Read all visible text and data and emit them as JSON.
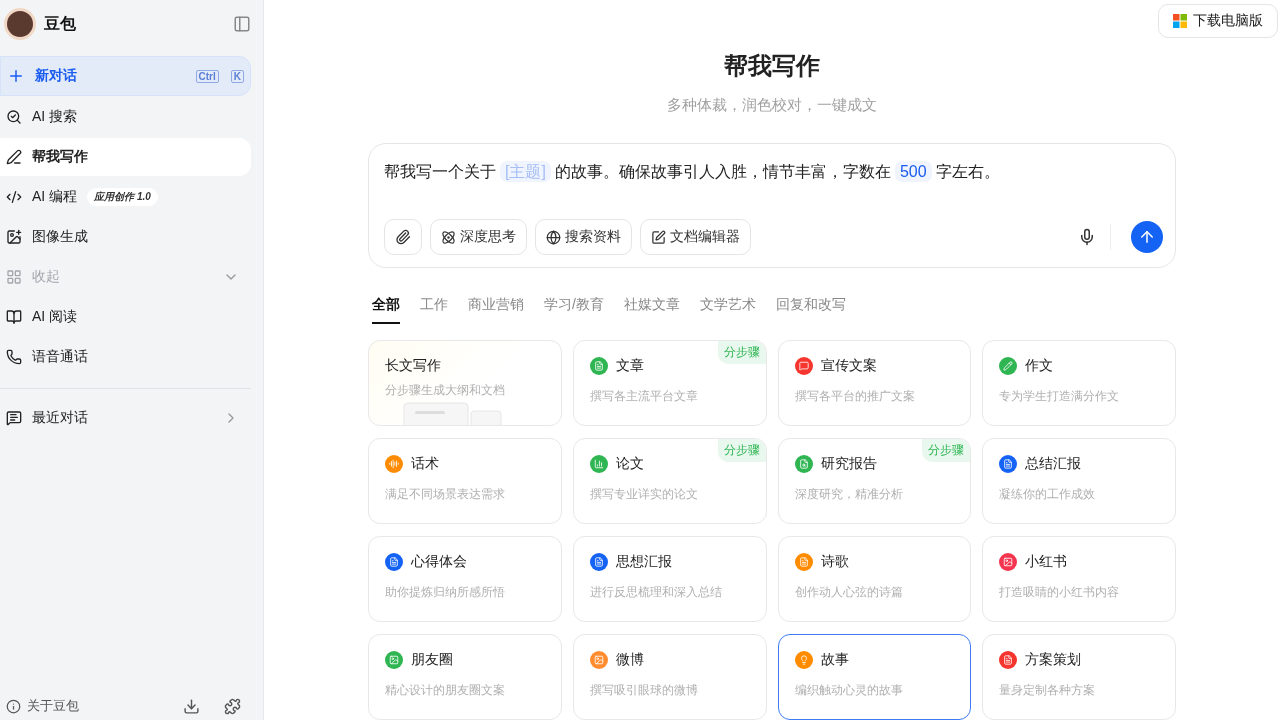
{
  "sidebar": {
    "app_name": "豆包",
    "new_chat": {
      "label": "新对话",
      "shortcut": [
        "Ctrl",
        "K"
      ]
    },
    "items": [
      {
        "kind": "search",
        "label": "AI 搜索",
        "selected": false
      },
      {
        "kind": "write",
        "label": "帮我写作",
        "selected": true
      },
      {
        "kind": "code",
        "label": "AI 编程",
        "selected": false,
        "badge": "应用创作 1.0"
      },
      {
        "kind": "image",
        "label": "图像生成",
        "selected": false
      },
      {
        "kind": "collapse",
        "label": "收起",
        "selected": false
      },
      {
        "kind": "read",
        "label": "AI 阅读",
        "selected": false
      },
      {
        "kind": "phone",
        "label": "语音通话",
        "selected": false
      }
    ],
    "recent": {
      "label": "最近对话"
    },
    "about": "关于豆包"
  },
  "download_button": "下载电脑版",
  "title": "帮我写作",
  "subtitle": "多种体裁，润色校对，一键成文",
  "prompt": {
    "segments": [
      {
        "kind": "text",
        "text": "帮我写一个关于"
      },
      {
        "kind": "slot",
        "text": "[主题]",
        "filled": false
      },
      {
        "kind": "text",
        "text": "的故事。确保故事引人入胜，情节丰富，字数在"
      },
      {
        "kind": "slot",
        "text": "500",
        "filled": true
      },
      {
        "kind": "text",
        "text": "字左右。"
      }
    ],
    "tools": [
      {
        "kind": "think",
        "label": "深度思考"
      },
      {
        "kind": "web",
        "label": "搜索资料"
      },
      {
        "kind": "doc",
        "label": "文档编辑器"
      }
    ]
  },
  "tabs": [
    {
      "label": "全部",
      "selected": true
    },
    {
      "label": "工作",
      "selected": false
    },
    {
      "label": "商业营销",
      "selected": false
    },
    {
      "label": "学习/教育",
      "selected": false
    },
    {
      "label": "社媒文章",
      "selected": false
    },
    {
      "label": "文学艺术",
      "selected": false
    },
    {
      "label": "回复和改写",
      "selected": false
    }
  ],
  "cards": [
    {
      "kind": "feature",
      "title": "长文写作",
      "desc": "分步骤生成大纲和文档",
      "selected": false
    },
    {
      "kind": "doc",
      "title": "文章",
      "desc": "撰写各主流平台文章",
      "color": "#2fb552",
      "badge": "分步骤",
      "selected": false
    },
    {
      "kind": "chat",
      "title": "宣传文案",
      "desc": "撰写各平台的推广文案",
      "color": "#f5352e",
      "selected": false
    },
    {
      "kind": "pen",
      "title": "作文",
      "desc": "专为学生打造满分作文",
      "color": "#2fb552",
      "selected": false
    },
    {
      "kind": "voice",
      "title": "话术",
      "desc": "满足不同场景表达需求",
      "color": "#ff8c00",
      "selected": false
    },
    {
      "kind": "chart",
      "title": "论文",
      "desc": "撰写专业详实的论文",
      "color": "#2fb552",
      "badge": "分步骤",
      "selected": false
    },
    {
      "kind": "report",
      "title": "研究报告",
      "desc": "深度研究，精准分析",
      "color": "#2fb552",
      "badge": "分步骤",
      "selected": false
    },
    {
      "kind": "doc",
      "title": "总结汇报",
      "desc": "凝练你的工作成效",
      "color": "#1463f5",
      "selected": false
    },
    {
      "kind": "doc",
      "title": "心得体会",
      "desc": "助你提炼归纳所感所悟",
      "color": "#1463f5",
      "selected": false
    },
    {
      "kind": "doc",
      "title": "思想汇报",
      "desc": "进行反思梳理和深入总结",
      "color": "#1463f5",
      "selected": false
    },
    {
      "kind": "doc",
      "title": "诗歌",
      "desc": "创作动人心弦的诗篇",
      "color": "#ff8c00",
      "selected": false
    },
    {
      "kind": "image",
      "title": "小红书",
      "desc": "打造吸睛的小红书内容",
      "color": "#f5354f",
      "selected": false
    },
    {
      "kind": "image",
      "title": "朋友圈",
      "desc": "精心设计的朋友圈文案",
      "color": "#2fb552",
      "selected": false
    },
    {
      "kind": "image",
      "title": "微博",
      "desc": "撰写吸引眼球的微博",
      "color": "#ff8c2e",
      "selected": false
    },
    {
      "kind": "idea",
      "title": "故事",
      "desc": "编织触动心灵的故事",
      "color": "#ff8c00",
      "selected": true
    },
    {
      "kind": "doc",
      "title": "方案策划",
      "desc": "量身定制各种方案",
      "color": "#f5352e",
      "selected": false
    }
  ]
}
